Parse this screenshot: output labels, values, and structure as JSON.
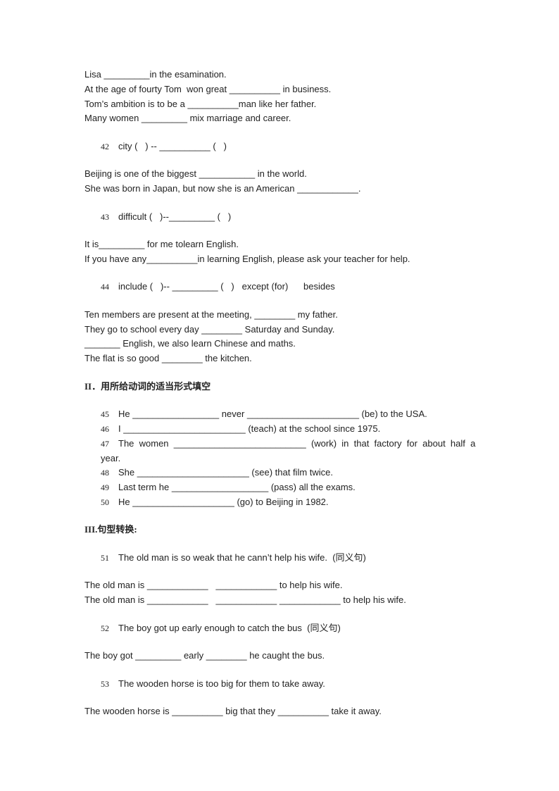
{
  "lines_a": [
    "Lisa _________in the esamination.",
    "At the age of fourty Tom  won great __________ in business.",
    "Tom’s ambition is to be a __________man like her father.",
    "Many women _________ mix marriage and career."
  ],
  "q42": {
    "num": "42",
    "text": "city (   ) -- __________ (   )"
  },
  "lines_b": [
    "Beijing is one of the biggest ___________ in the world.",
    "She was born in Japan, but now she is an American ____________."
  ],
  "q43": {
    "num": "43",
    "text": "difficult (   )--_________ (   )"
  },
  "lines_c": [
    "It is_________ for me tolearn English.",
    "If you have any__________in learning English, please ask your teacher for help."
  ],
  "q44": {
    "num": "44",
    "text": "include (   )-- _________ (   )   except (for)      besides"
  },
  "lines_d": [
    "Ten members are present at the meeting, ________ my father.",
    "They go to school every day ________ Saturday and Sunday.",
    "_______ English, we also learn Chinese and maths.",
    "The flat is so good ________ the kitchen."
  ],
  "section2": "II．用所给动词的适当形式填空",
  "items2": [
    {
      "num": "45",
      "text": "He _________________ never ______________________ (be) to the USA."
    },
    {
      "num": "46",
      "text": "I ________________________ (teach) at the school since 1975."
    },
    {
      "num": "47",
      "text": "The  women  __________________________  (work)  in  that  factory  for  about  half  a"
    },
    {
      "num": "48",
      "text": "She ______________________ (see) that film twice."
    },
    {
      "num": "49",
      "text": "Last term he ___________________ (pass) all the exams."
    },
    {
      "num": "50",
      "text": "He ____________________ (go) to Beijing in 1982."
    }
  ],
  "item47_cont": "year.",
  "section3": "III.句型转换:",
  "q51": {
    "num": "51",
    "text": "The old man is so weak that he cann’t help his wife.  (同义句)"
  },
  "lines_e": [
    "The old man is ____________   ____________ to help his wife.",
    "The old man is ____________   ____________ ____________ to help his wife."
  ],
  "q52": {
    "num": "52",
    "text": "The boy got up early enough to catch the bus  (同义句)"
  },
  "line_f": "The boy got _________ early ________ he caught the bus.",
  "q53": {
    "num": "53",
    "text": "The wooden horse is too big for them to take away."
  },
  "line_g": "The wooden horse is __________ big that they __________ take it away."
}
